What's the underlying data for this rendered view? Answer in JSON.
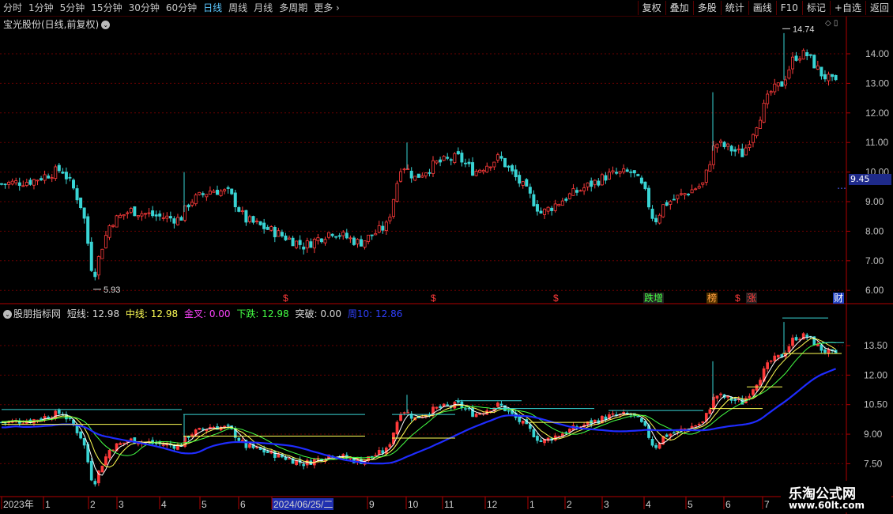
{
  "toolbar": {
    "periods": [
      "分时",
      "1分钟",
      "5分钟",
      "15分钟",
      "30分钟",
      "60分钟",
      "日线",
      "周线",
      "月线",
      "多周期",
      "更多"
    ],
    "active_period": "日线",
    "actions": [
      "复权",
      "叠加",
      "多股",
      "统计",
      "画线",
      "F10",
      "标记",
      "+自选",
      "返回"
    ]
  },
  "main": {
    "title": "宝光股份(日线,前复权)",
    "high_label": "14.74",
    "low_label": "5.93",
    "current_price": "9.45",
    "axis_ticks": [
      "14.00",
      "13.00",
      "12.00",
      "11.00",
      "10.00",
      "9.00",
      "8.00",
      "7.00",
      "6.00"
    ],
    "event_markers": [
      "$",
      "$",
      "$",
      "跌增",
      "榜",
      "$",
      "涨",
      "财"
    ]
  },
  "indicator": {
    "name": "股朋指标网",
    "short_label": "短线:",
    "short_value": "12.98",
    "mid_label": "中线:",
    "mid_value": "12.98",
    "cross_label": "金叉:",
    "cross_value": "0.00",
    "down_label": "下跌:",
    "down_value": "12.98",
    "break_label": "突破:",
    "break_value": "0.00",
    "week_label": "周10:",
    "week_value": "12.86",
    "axis_ticks": [
      "13.50",
      "12.00",
      "10.50",
      "9.00",
      "7.50"
    ]
  },
  "date_axis": {
    "labels": [
      "2023年",
      "1",
      "2",
      "3",
      "4",
      "5",
      "6",
      "2024/06/25/二",
      "9",
      "10",
      "11",
      "12",
      "1",
      "2",
      "3",
      "4",
      "5",
      "6",
      "7"
    ]
  },
  "watermark": {
    "line1": "乐淘公式网",
    "line2": "www.60lt.com"
  },
  "colors": {
    "up": "#ff3b3b",
    "down": "#39d4d4",
    "week_line": "#1f2cff",
    "grid": "#7a0000"
  }
}
